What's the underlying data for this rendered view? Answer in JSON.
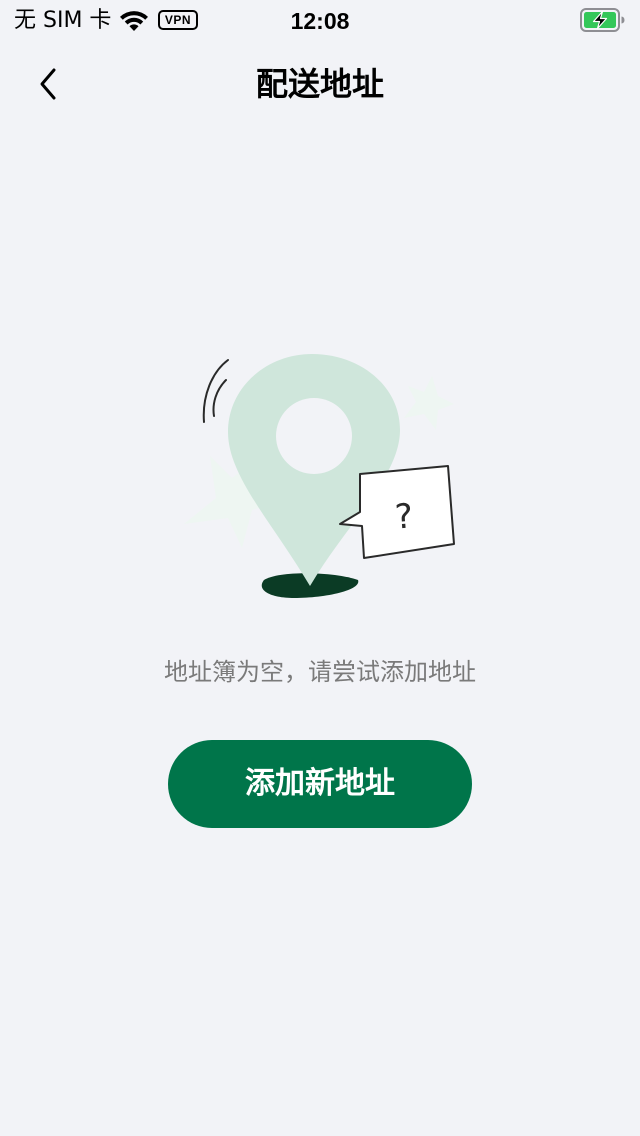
{
  "status_bar": {
    "carrier": "无 SIM 卡",
    "vpn": "VPN",
    "time": "12:08",
    "wifi_icon": "wifi-icon",
    "battery_icon": "battery-charging-icon",
    "battery_color": "#34c759"
  },
  "nav": {
    "back_icon": "chevron-left-icon",
    "title": "配送地址"
  },
  "empty_state": {
    "illustration": "location-pin-question-illustration",
    "message": "地址簿为空，请尝试添加地址",
    "add_button_label": "添加新地址"
  },
  "colors": {
    "background": "#f2f3f7",
    "primary": "#00754a",
    "pin": "#cfe6db",
    "pin_shadow": "#0b3b25",
    "message_text": "#7a7a7a"
  }
}
